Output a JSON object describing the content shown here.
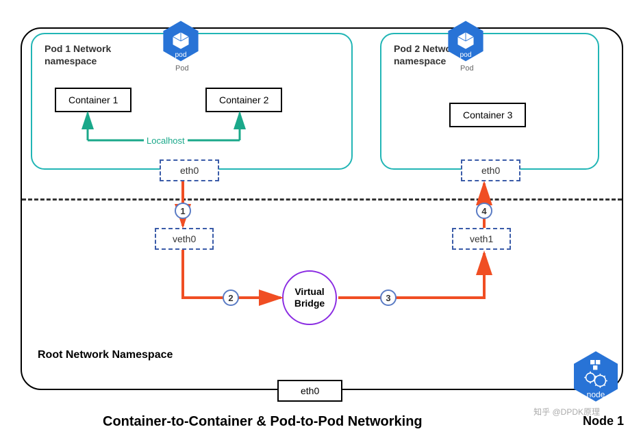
{
  "pods": {
    "pod1": {
      "title": "Pod 1 Network\nnamespace",
      "eth": "eth0",
      "icon_label": "pod",
      "icon_caption": "Pod"
    },
    "pod2": {
      "title": "Pod 2 Network\nnamespace",
      "eth": "eth0",
      "icon_label": "pod",
      "icon_caption": "Pod"
    }
  },
  "containers": {
    "c1": "Container 1",
    "c2": "Container 2",
    "c3": "Container 3"
  },
  "localhost": "Localhost",
  "veth": {
    "v0": "veth0",
    "v1": "veth1"
  },
  "bridge": "Virtual\nBridge",
  "root_ns": "Root Network Namespace",
  "root_eth": "eth0",
  "title": "Container-to-Container & Pod-to-Pod Networking",
  "node_label": "Node 1",
  "node_icon_label": "node",
  "steps": {
    "s1": "1",
    "s2": "2",
    "s3": "3",
    "s4": "4"
  },
  "watermark": "知乎 @DPDK原理",
  "colors": {
    "teal": "#21b5b5",
    "green": "#1aa88a",
    "orange": "#f04e23",
    "blue": "#2873d6",
    "purple": "#8a2be2",
    "navy": "#3a5ba8"
  }
}
